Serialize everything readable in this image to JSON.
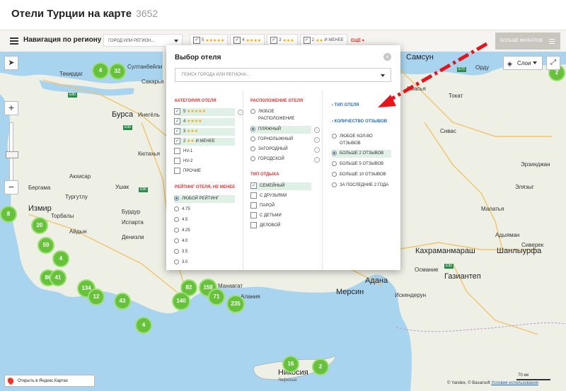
{
  "header": {
    "title": "Отели Турции на карте",
    "count": "3652"
  },
  "filterbar": {
    "nav_label": "Навигация по региону",
    "region_placeholder": "ГОРОД ИЛИ РЕГИОН...",
    "star_filters": [
      {
        "num": "5",
        "stars": "★★★★★"
      },
      {
        "num": "4",
        "stars": "★★★★"
      },
      {
        "num": "3",
        "stars": "★★★"
      },
      {
        "num": "2",
        "stars": "★★",
        "suffix": "И МЕНЕЕ"
      }
    ],
    "more_link": "ЕЩЁ",
    "more_filters": "БОЛЬШЕ ФИЛЬТРОВ"
  },
  "map": {
    "layers_label": "Слои",
    "open_yandex": "Открыть в Яндекс.Картах",
    "copyright_prefix": "© Yandex, © Basarsoft",
    "terms": "Условия использования",
    "scale": "70 км",
    "places_big": [
      "Бурса",
      "Измир",
      "Анкара",
      "Мерсин",
      "Кахраманмараш",
      "Шанлыурфа",
      "Газиантеп",
      "Адана",
      "Никосия",
      "Самсун"
    ],
    "places": [
      "Текирдаг",
      "Султанбейли",
      "Сакарья",
      "Инегёль",
      "Кютахья",
      "Ушак",
      "Акхисар",
      "Тургутлу",
      "Торбалы",
      "Айдын",
      "Денизли",
      "Бурдур",
      "Испарта",
      "Манавгат",
      "Алания",
      "Аланья",
      "Сивас",
      "Малатья",
      "Адыяман",
      "Искендерун",
      "Османие",
      "Элязыг",
      "Сиверек",
      "Лефкоша",
      "Бергама",
      "Орду",
      "Токат",
      "Амасья",
      "Эрзинджан"
    ],
    "clusters": [
      "4",
      "32",
      "8",
      "20",
      "59",
      "4",
      "86",
      "41",
      "134",
      "12",
      "43",
      "4",
      "82",
      "158",
      "71",
      "140",
      "235",
      "16",
      "2",
      "2"
    ]
  },
  "dialog": {
    "title": "Выбор отеля",
    "search_placeholder": "ПОИСК ГОРОДА ИЛИ РЕГИОНА...",
    "category": {
      "heading": "КАТЕГОРИЯ ОТЕЛЯ",
      "items": [
        {
          "num": "5",
          "stars": "★★★★★",
          "suffix": ""
        },
        {
          "num": "4",
          "stars": "★★★★",
          "suffix": ""
        },
        {
          "num": "3",
          "stars": "★★★",
          "suffix": ""
        },
        {
          "num": "2",
          "stars": "★★",
          "suffix": "И МЕНЕЕ"
        },
        {
          "num": "HV-1",
          "stars": "",
          "suffix": ""
        },
        {
          "num": "HV-2",
          "stars": "",
          "suffix": ""
        },
        {
          "num": "ПРОЧИЕ",
          "stars": "",
          "suffix": ""
        }
      ]
    },
    "rating": {
      "heading": "РЕЙТИНГ ОТЕЛЯ, НЕ МЕНЕЕ",
      "items": [
        "ЛЮБОЙ РЕЙТИНГ",
        "4.75",
        "4.5",
        "4.25",
        "4.0",
        "3.5",
        "3.0"
      ]
    },
    "location": {
      "heading": "РАСПОЛОЖЕНИЕ ОТЕЛЯ",
      "items": [
        "ЛЮБОЕ",
        "РАСПОЛОЖЕНИЕ",
        "ПЛЯЖНЫЙ",
        "ГОРНОЛЫЖНЫЙ",
        "ЗАГОРОДНЫЙ",
        "ГОРОДСКОЙ"
      ]
    },
    "rest": {
      "heading": "ТИП ОТДЫХА",
      "items": [
        "СЕМЕЙНЫЙ",
        "С ДРУЗЬЯМИ",
        "ПАРОЙ",
        "С ДЕТЬМИ",
        "ДЕЛОВОЙ"
      ]
    },
    "hotel_type": {
      "heading": "ТИП ОТЕЛЯ"
    },
    "reviews": {
      "heading": "КОЛИЧЕСТВО ОТЗЫВОВ",
      "items": [
        "ЛЮБОЕ КОЛ-ВО",
        "ОТЗЫВОВ",
        "БОЛЬШЕ 2 ОТЗЫВОВ",
        "БОЛЬШЕ 5 ОТЗЫВОВ",
        "БОЛЬШЕ 10 ОТЗЫВОВ",
        "ЗА ПОСЛЕДНИЕ 2 ГОДА"
      ]
    }
  },
  "colors": {
    "cluster": "#66c23a",
    "accent_red": "#d33333",
    "link_blue": "#2a6fb0",
    "highlight": "#dff0e6"
  }
}
